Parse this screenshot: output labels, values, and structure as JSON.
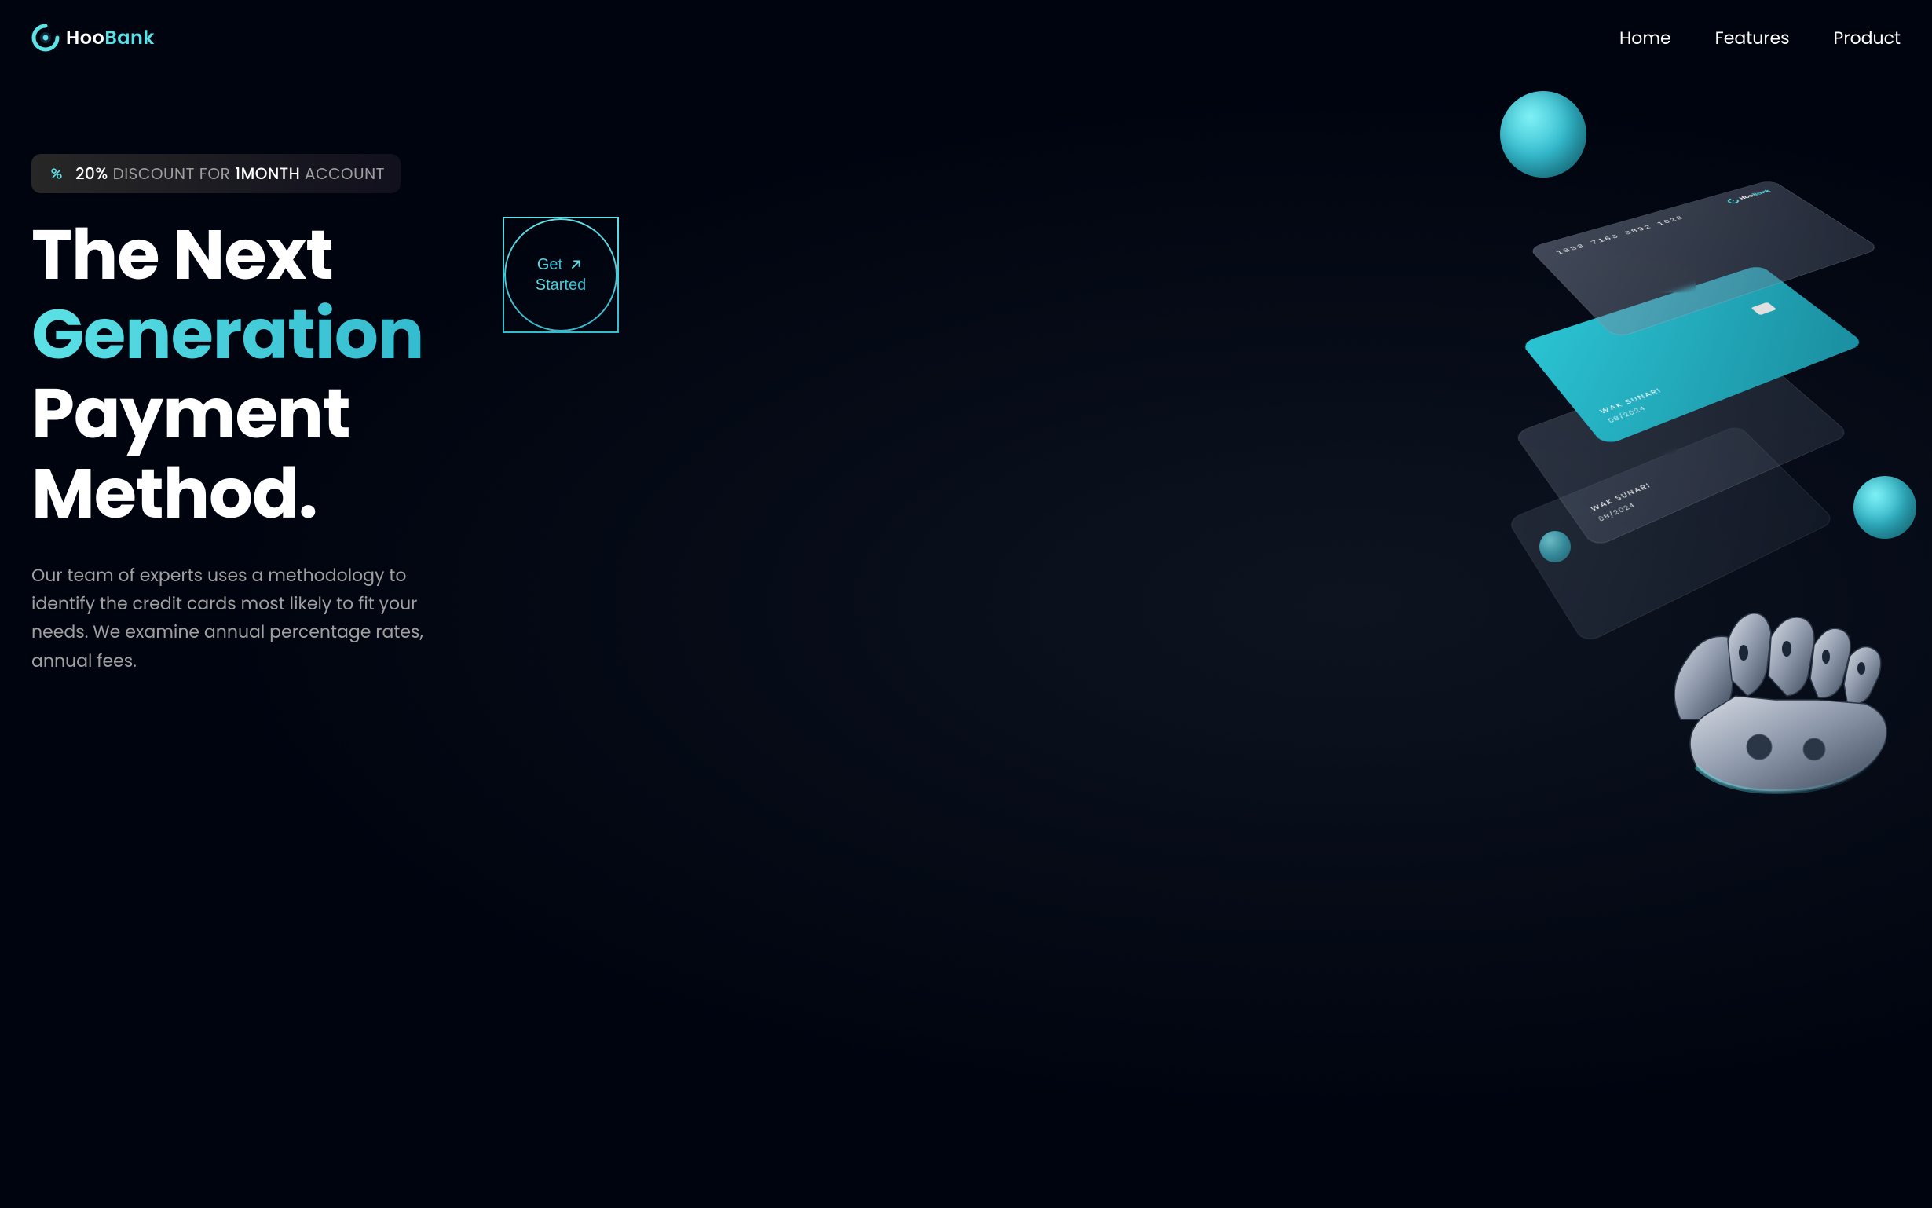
{
  "brand": {
    "name_part1": "Hoo",
    "name_part2": "Bank"
  },
  "nav": {
    "items": [
      {
        "label": "Home"
      },
      {
        "label": "Features"
      },
      {
        "label": "Product"
      }
    ]
  },
  "discount": {
    "percent": "20%",
    "text1": " DISCOUNT FOR ",
    "month": "1MONTH",
    "text2": " ACCOUNT"
  },
  "hero": {
    "title_line1": "The Next",
    "title_line2": "Generation",
    "title_line3": "Payment Method.",
    "description": "Our team of experts uses a methodology to identify the credit cards most likely to fit your needs. We examine annual percentage rates, annual fees."
  },
  "cta": {
    "line1": "Get",
    "line2": "Started"
  },
  "card": {
    "number": "1833 7163 3892 1028",
    "name": "WAK SUNARI",
    "date": "08/2024",
    "brand_part1": "Hoo",
    "brand_part2": "Bank"
  }
}
